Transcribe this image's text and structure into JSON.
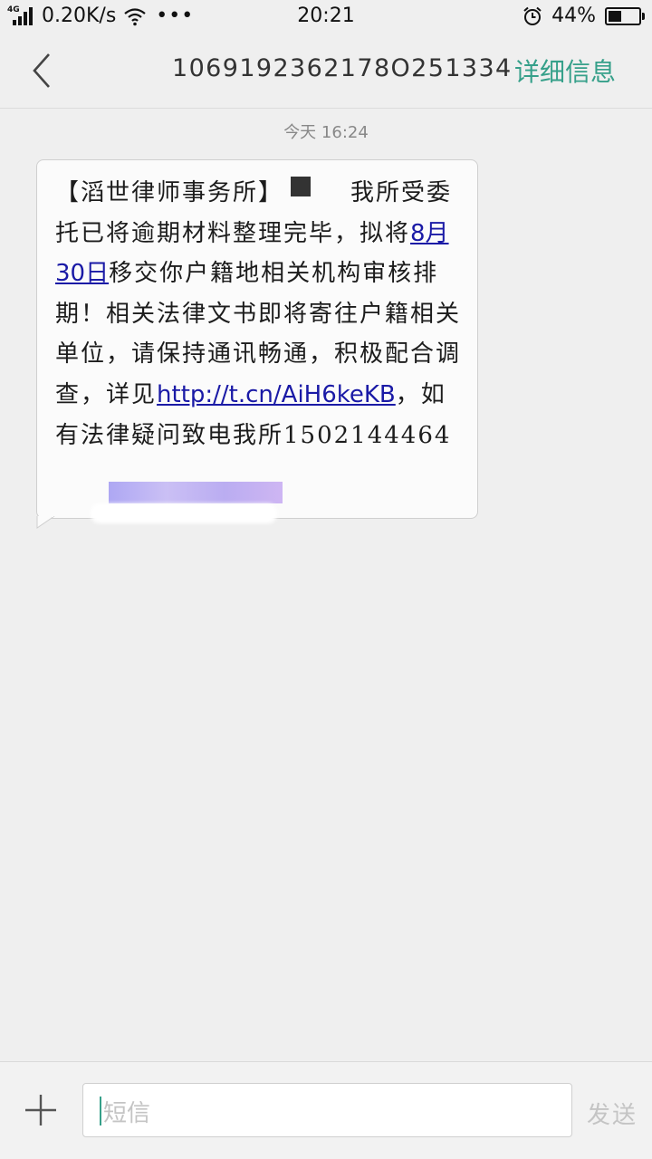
{
  "status_bar": {
    "network": "4G",
    "speed": "0.20K/s",
    "more": "•••",
    "time": "20:21",
    "battery_percent": "44%",
    "battery_level": 0.44
  },
  "header": {
    "title": "1069192362178O251334",
    "detail_label": "详细信息"
  },
  "message": {
    "time": "今天  16:24",
    "part1": "【滔世律师事务所】",
    "part2": "我所受委托已将逾期材料整理完毕，拟将",
    "date_link": "8月30日",
    "part3": "移交你户籍地相关机构审核排期！相关法律文书即将寄往户籍相关单位，请保持通讯畅通，积极配合调查，详见",
    "url_link": "http://t.cn/AiH6keKB",
    "part4": "，如有法律疑问致电我所",
    "phone_partial": "1502144464"
  },
  "composer": {
    "placeholder": "短信",
    "send_label": "发送"
  },
  "colors": {
    "accent": "#36a08a",
    "link": "#1a1aa6"
  }
}
